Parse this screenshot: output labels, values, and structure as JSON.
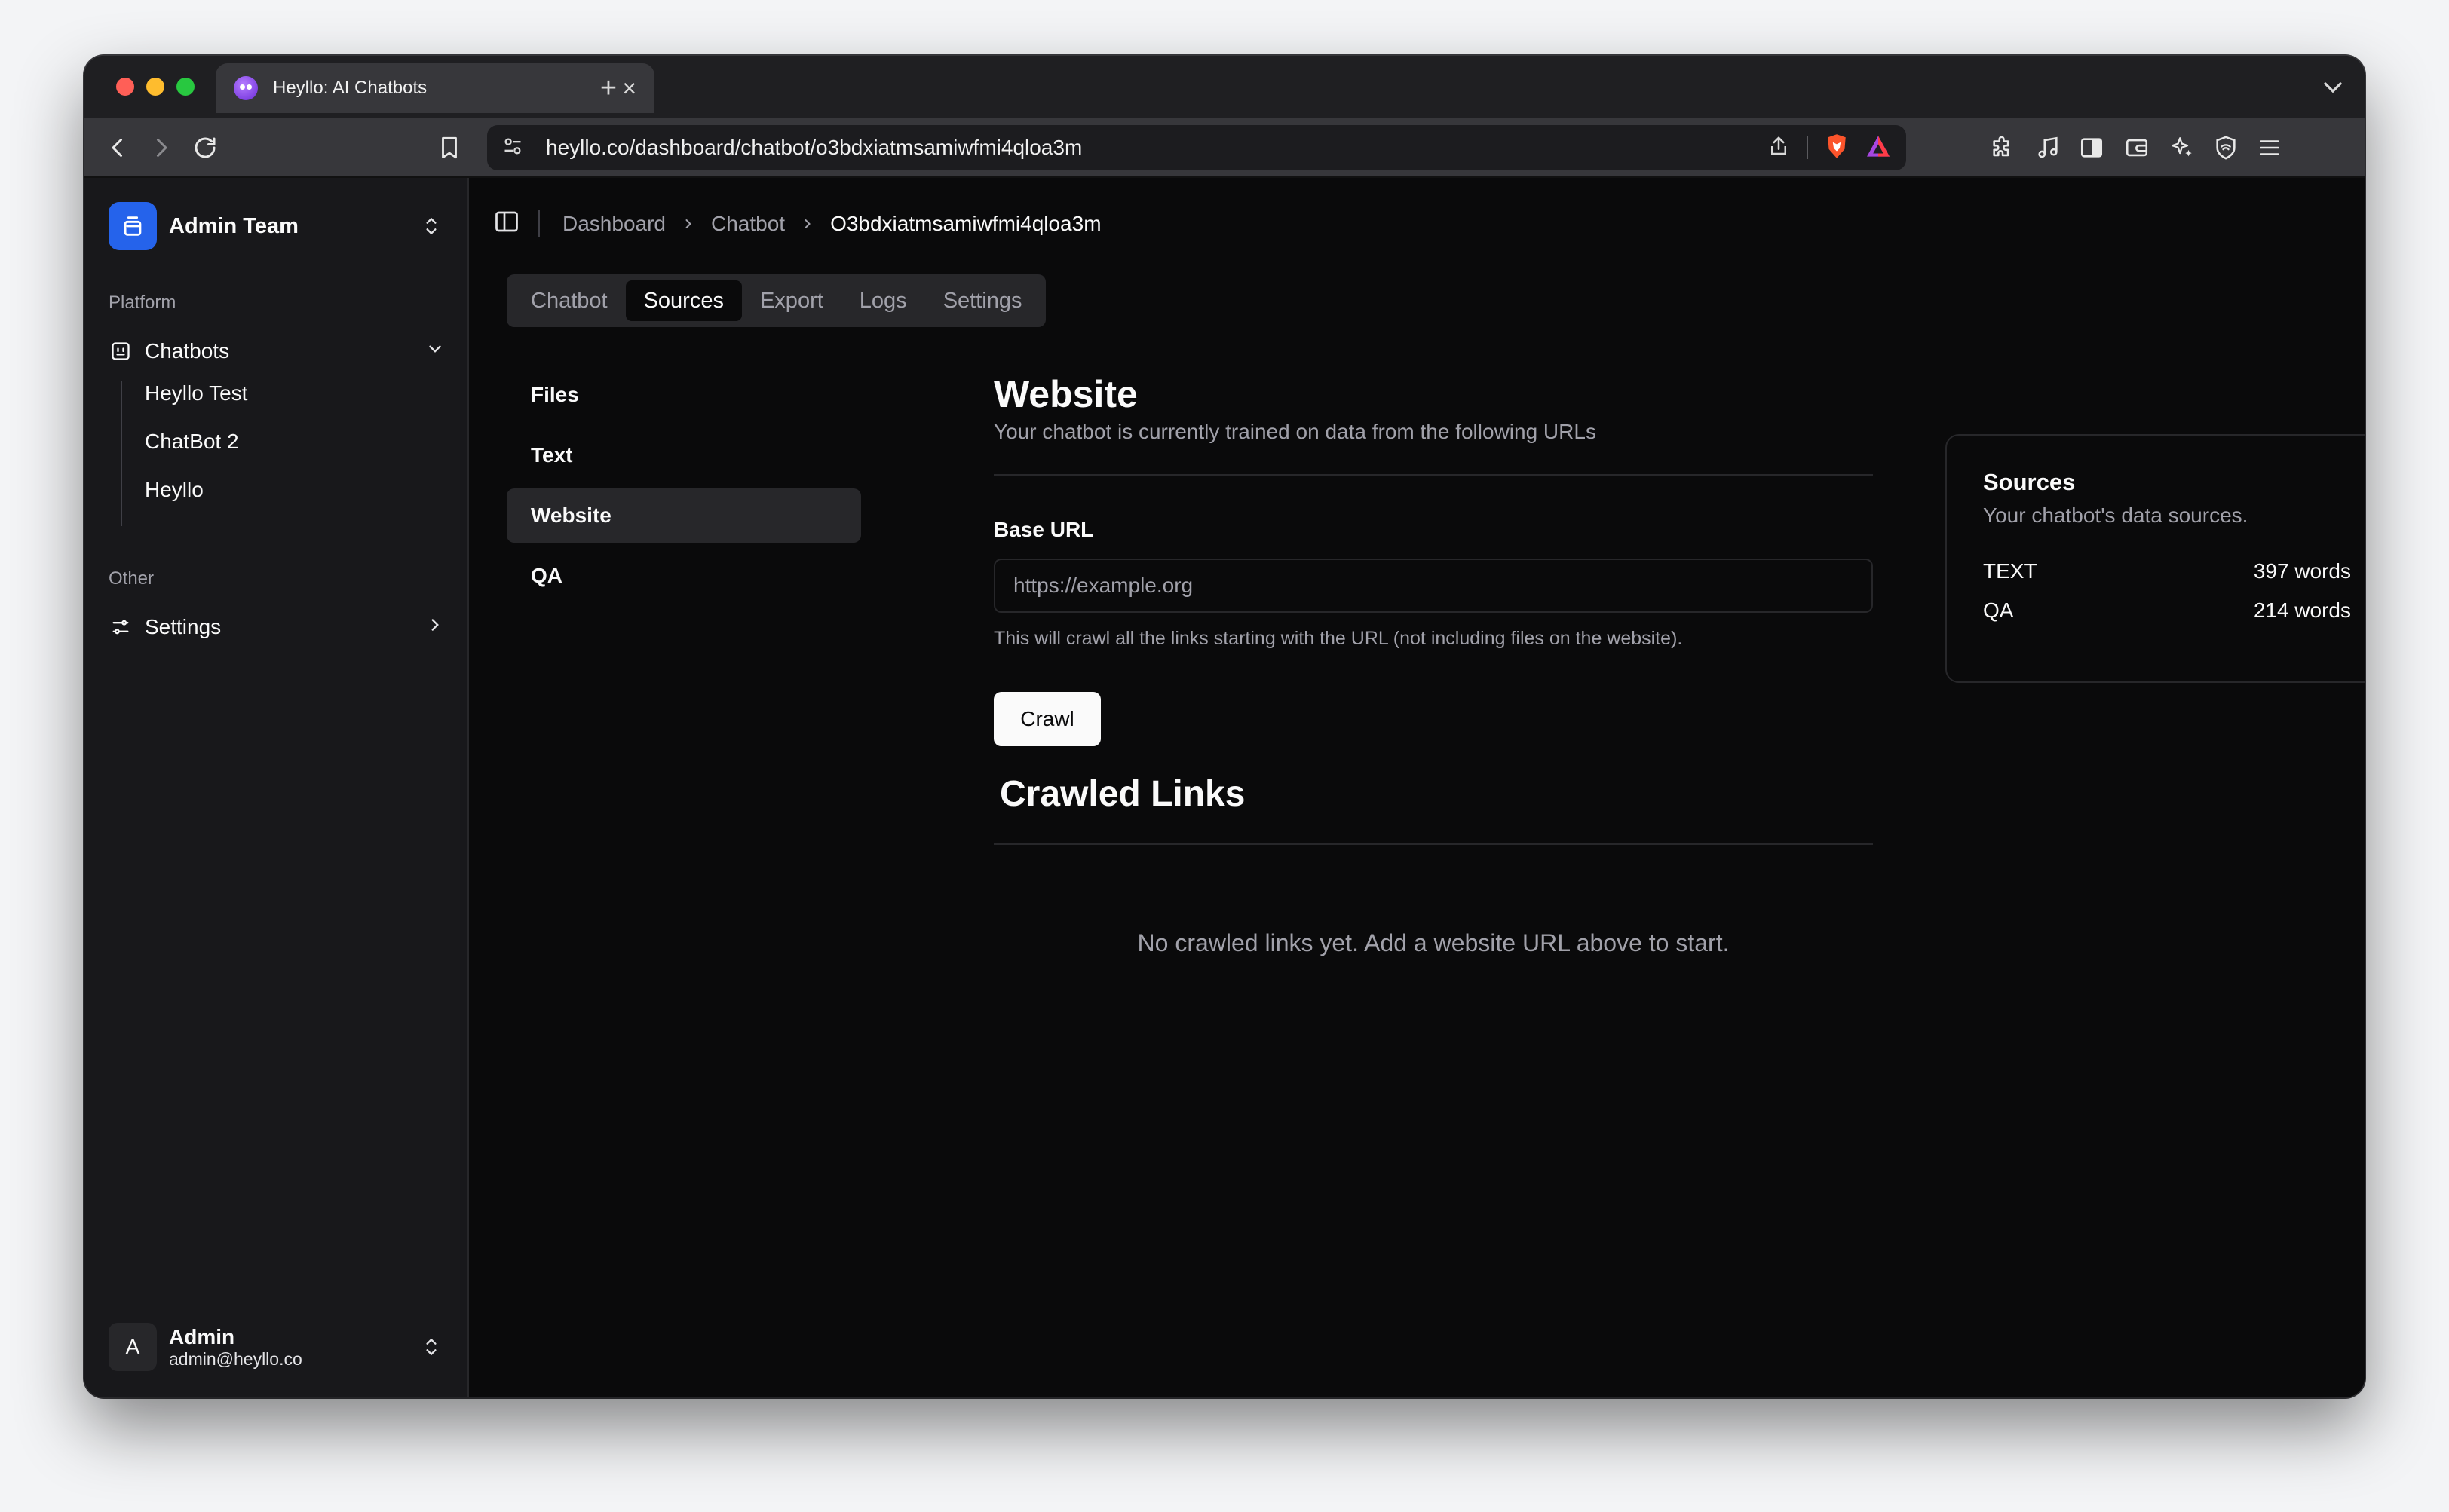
{
  "browser": {
    "tab_title": "Heyllo: AI Chatbots",
    "url": "heyllo.co/dashboard/chatbot/o3bdxiatmsamiwfmi4qloa3m"
  },
  "sidebar": {
    "team_name": "Admin Team",
    "platform_label": "Platform",
    "chatbots_label": "Chatbots",
    "chatbots": [
      "Heyllo Test",
      "ChatBot 2",
      "Heyllo"
    ],
    "other_label": "Other",
    "settings_label": "Settings",
    "user": {
      "avatar_initial": "A",
      "name": "Admin",
      "email": "admin@heyllo.co"
    }
  },
  "breadcrumb": {
    "dashboard": "Dashboard",
    "chatbot": "Chatbot",
    "current": "O3bdxiatmsamiwfmi4qloa3m"
  },
  "tabs": [
    "Chatbot",
    "Sources",
    "Export",
    "Logs",
    "Settings"
  ],
  "active_tab": "Sources",
  "source_nav": [
    "Files",
    "Text",
    "Website",
    "QA"
  ],
  "active_source": "Website",
  "website": {
    "title": "Website",
    "subtitle": "Your chatbot is currently trained on data from the following URLs",
    "base_url_label": "Base URL",
    "base_url_placeholder": "https://example.org",
    "help_text": "This will crawl all the links starting with the URL (not including files on the website).",
    "crawl_button": "Crawl",
    "crawled_title": "Crawled Links",
    "empty_text": "No crawled links yet. Add a website URL above to start."
  },
  "sources_card": {
    "title": "Sources",
    "subtitle": "Your chatbot's data sources.",
    "rows": [
      {
        "type": "TEXT",
        "count": "397 words"
      },
      {
        "type": "QA",
        "count": "214 words"
      }
    ]
  },
  "colors": {
    "background": "#0a0a0b",
    "sidebar": "#18181b",
    "accent": "#2563eb",
    "muted_text": "#a1a1aa",
    "border": "#27272a"
  }
}
